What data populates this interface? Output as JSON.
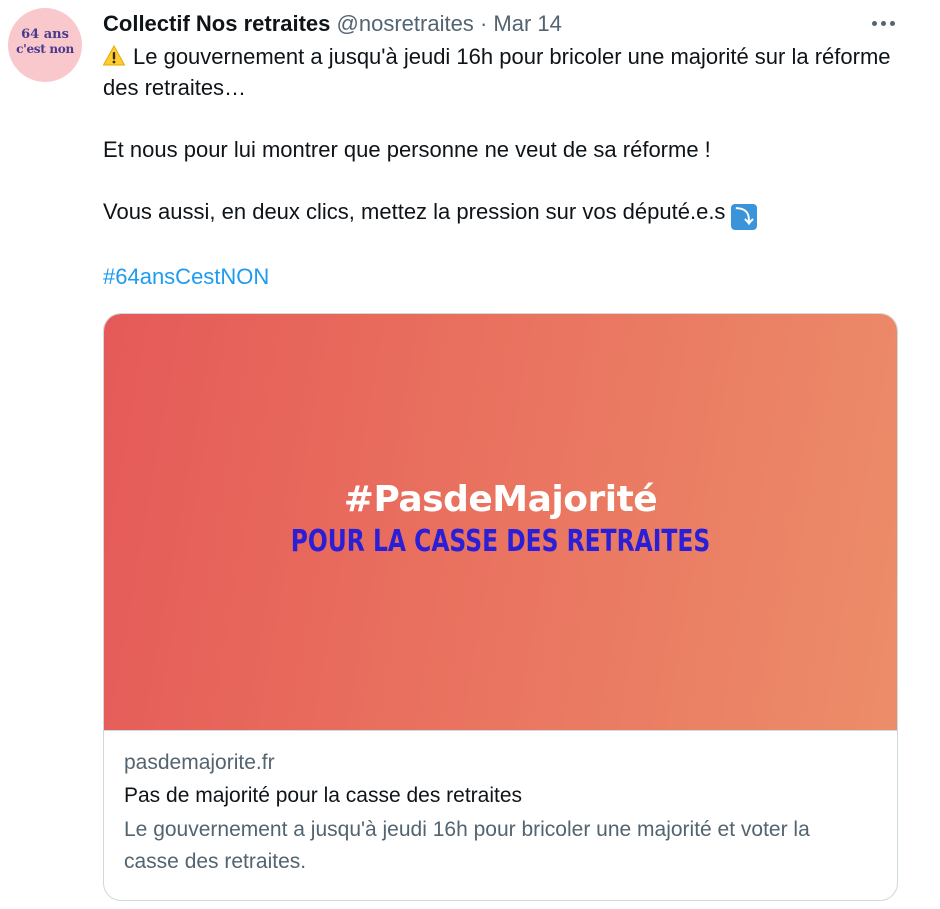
{
  "avatar": {
    "line1": "64 ans",
    "line2": "c'est non"
  },
  "header": {
    "display_name": "Collectif Nos retraites",
    "handle": "@nosretraites",
    "separator": "·",
    "date": "Mar 14"
  },
  "tweet": {
    "line1": "Le gouvernement a jusqu'à jeudi 16h pour bricoler une majorité sur la réforme des retraites…",
    "line2": "Et nous pour lui montrer que personne ne veut de sa réforme !",
    "line3": "Vous aussi, en deux clics, mettez la pression sur vos député.e.s",
    "hashtag": "#64ansCestNON",
    "icons": [
      "warning-icon",
      "arrow-down-icon"
    ]
  },
  "card": {
    "image_title": "#PasdeMajorité",
    "image_subtitle": "POUR LA CASSE DES RETRAITES",
    "domain": "pasdemajorite.fr",
    "title": "Pas de majorité pour la casse des retraites",
    "description": "Le gouvernement a jusqu'à jeudi 16h pour bricoler une majorité et voter la casse des retraites."
  },
  "colors": {
    "hashtag": "#1d9bf0",
    "secondary_text": "#536471",
    "card_gradient_start": "#e55a58",
    "card_gradient_end": "#ec8d69",
    "subtitle": "#2a1fd6"
  }
}
